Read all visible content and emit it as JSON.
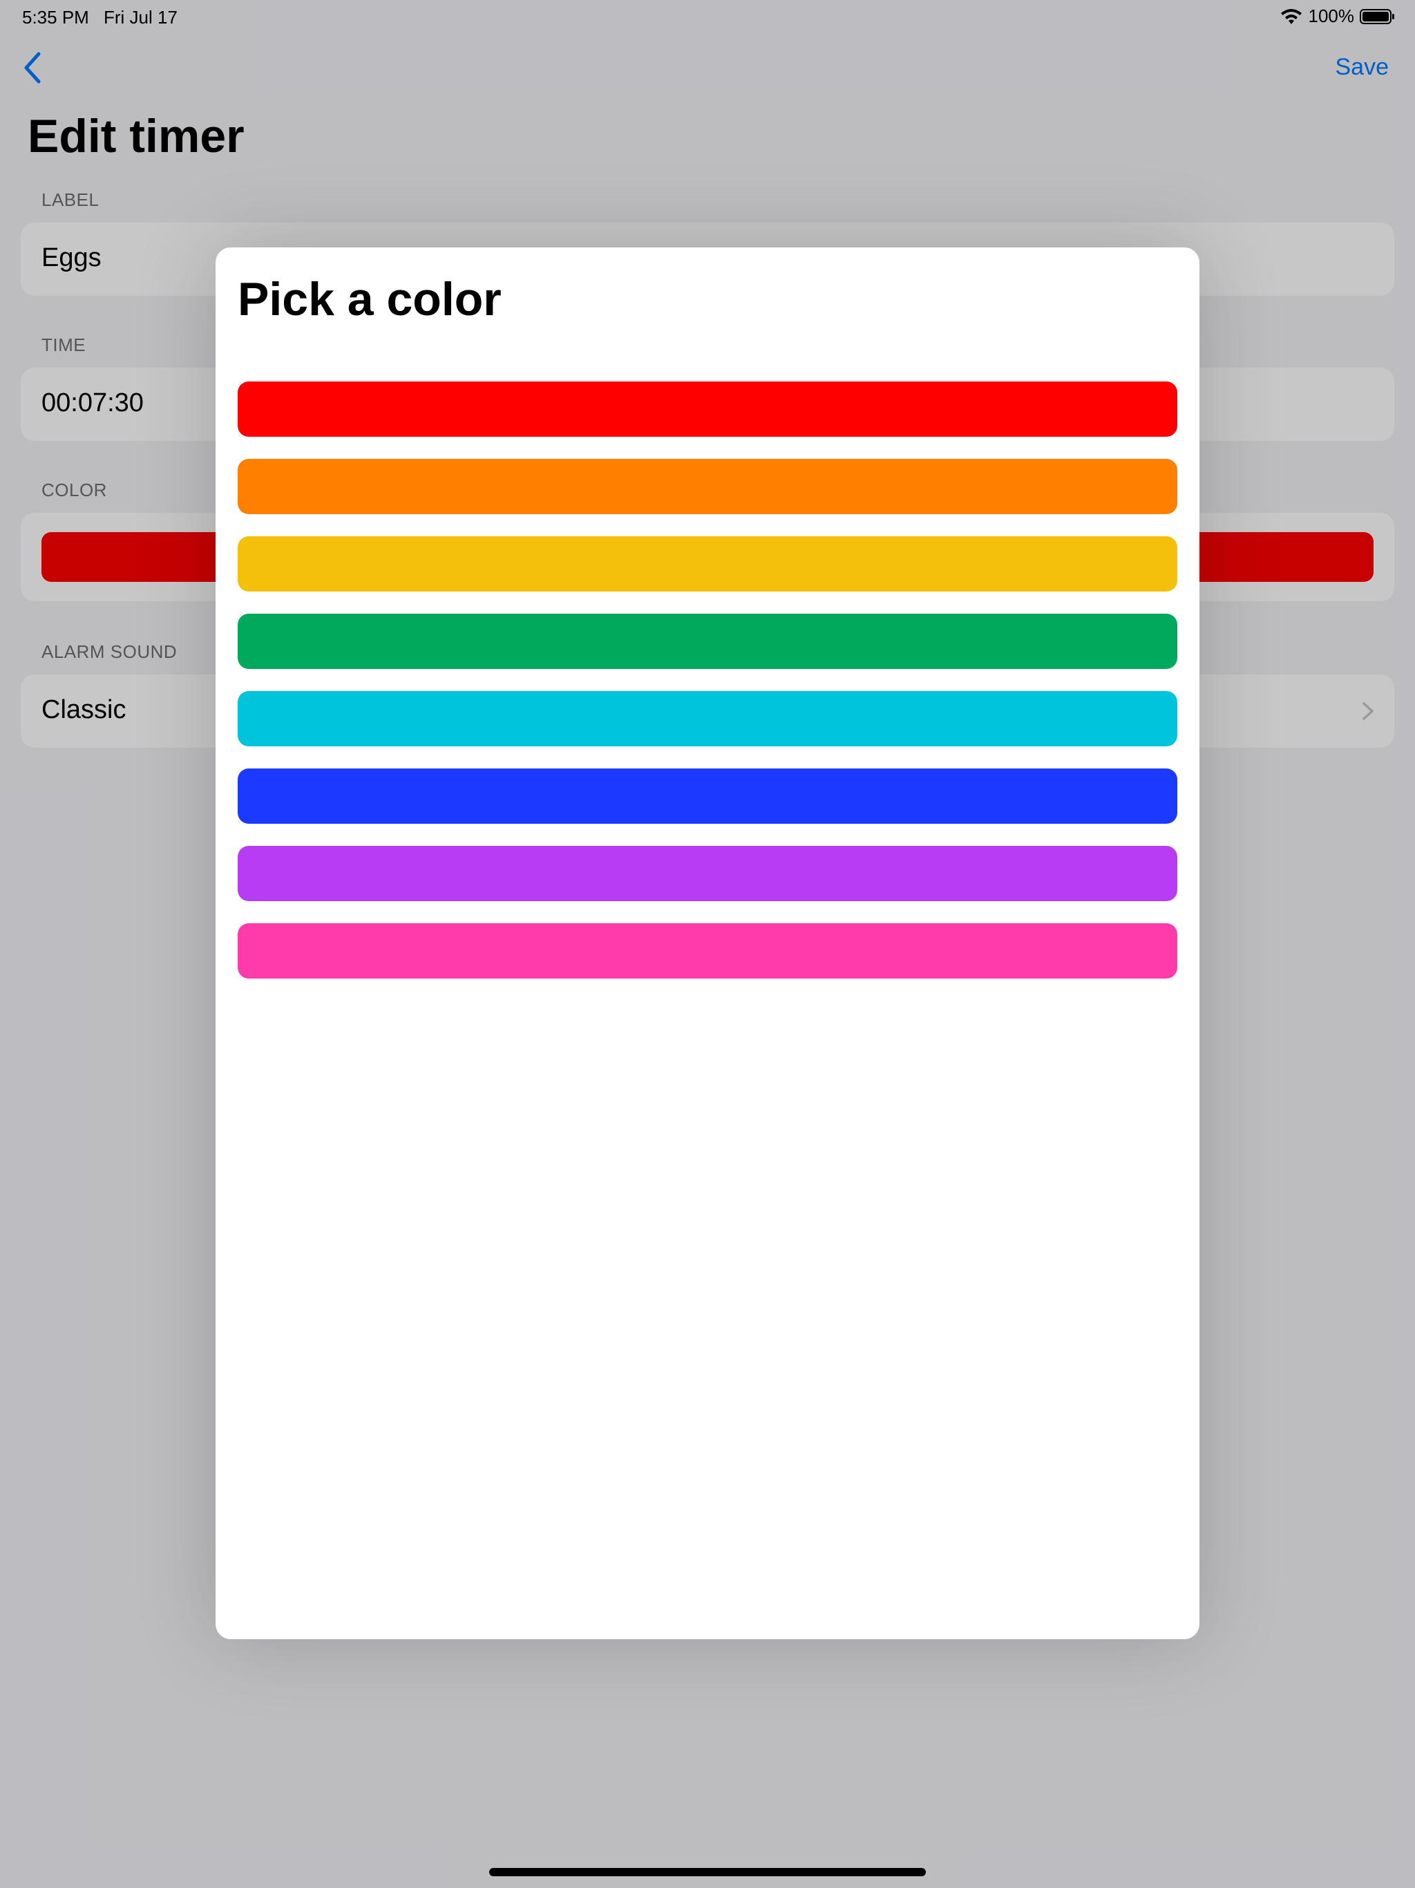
{
  "status_bar": {
    "time": "5:35 PM",
    "date": "Fri Jul 17",
    "battery": "100%"
  },
  "nav": {
    "back_icon": "chevron-left-icon",
    "save_label": "Save"
  },
  "page": {
    "title": "Edit timer"
  },
  "form": {
    "label": {
      "header": "LABEL",
      "value": "Eggs"
    },
    "time": {
      "header": "TIME",
      "value": "00:07:30"
    },
    "color": {
      "header": "COLOR",
      "value": "#ff0000"
    },
    "alarm_sound": {
      "header": "ALARM SOUND",
      "value": "Classic"
    }
  },
  "modal": {
    "title": "Pick a color",
    "colors": [
      {
        "name": "red",
        "hex": "#ff0000"
      },
      {
        "name": "orange",
        "hex": "#ff8000"
      },
      {
        "name": "yellow",
        "hex": "#f5c00c"
      },
      {
        "name": "green",
        "hex": "#00a95c"
      },
      {
        "name": "cyan",
        "hex": "#00c3dc"
      },
      {
        "name": "blue",
        "hex": "#1a3bff"
      },
      {
        "name": "purple",
        "hex": "#b93cf5"
      },
      {
        "name": "pink",
        "hex": "#ff3aaa"
      }
    ]
  },
  "theme": {
    "accent": "#007aff",
    "group_background": "#ffffff",
    "page_background": "#f2f2f7"
  }
}
